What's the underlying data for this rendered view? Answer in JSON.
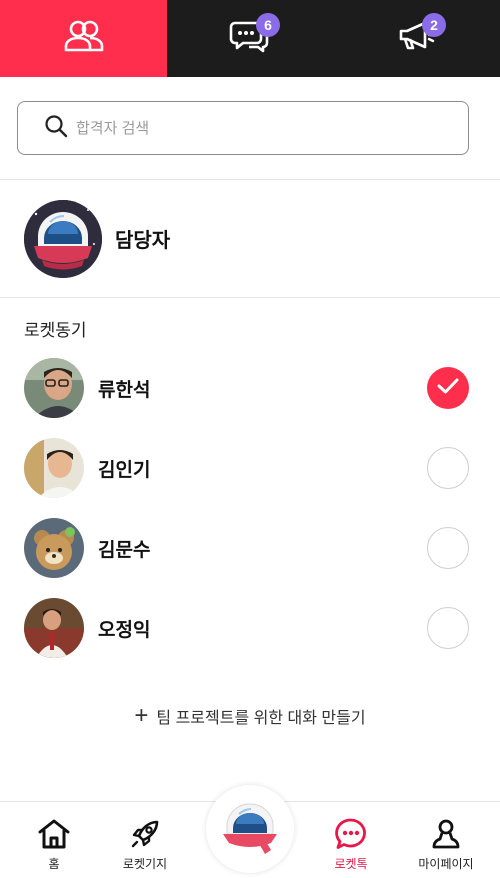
{
  "top_tabs": [
    {
      "name": "members",
      "icon": "people-icon",
      "active": true
    },
    {
      "name": "chat",
      "icon": "chat-bubbles-icon",
      "badge": "6"
    },
    {
      "name": "notice",
      "icon": "megaphone-icon",
      "badge": "2"
    }
  ],
  "colors": {
    "accent": "#ff2e4d",
    "dark": "#1c1c1c",
    "badge": "#8b6ce8"
  },
  "search": {
    "placeholder": "합격자 검색",
    "value": ""
  },
  "manager": {
    "name": "담당자"
  },
  "section": {
    "title": "로켓동기"
  },
  "members": [
    {
      "name": "류한석",
      "checked": true
    },
    {
      "name": "김인기",
      "checked": false
    },
    {
      "name": "김문수",
      "checked": false
    },
    {
      "name": "오정익",
      "checked": false
    }
  ],
  "create_team": {
    "plus": "+",
    "label": "팀 프로젝트를 위한 대화 만들기"
  },
  "bottom_nav": {
    "home": "홈",
    "base": "로켓기지",
    "talk": "로켓톡",
    "my": "마이페이지"
  }
}
